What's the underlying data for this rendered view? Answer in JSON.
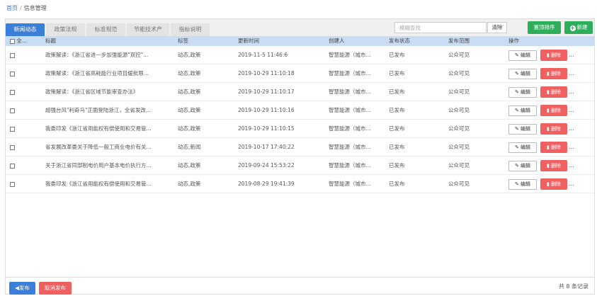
{
  "breadcrumb": {
    "home": "首页",
    "separator": "/",
    "current": "信息管理"
  },
  "tabs": [
    {
      "label": "新闻动态",
      "active": true
    },
    {
      "label": "政策法规",
      "active": false
    },
    {
      "label": "标准规范",
      "active": false
    },
    {
      "label": "节能技术产",
      "active": false
    },
    {
      "label": "指标说明",
      "active": false
    }
  ],
  "search": {
    "placeholder": "模糊查找",
    "value": ""
  },
  "buttons": {
    "clear": "清除",
    "sort": "置顶排序",
    "new": "新建",
    "edit": "编辑",
    "delete": "删除",
    "more": "...",
    "publish": "发布",
    "unpublish": "取消发布"
  },
  "table": {
    "headers": {
      "select_all": "全...",
      "title": "标题",
      "tags": "标签",
      "updated": "更新时间",
      "creator": "创建人",
      "status": "发布状态",
      "scope": "发布范围",
      "actions": "操作"
    },
    "rows": [
      {
        "title": "政策解读：《浙江省进一步加强能源\"双控\"...",
        "tags": "动态,政策",
        "updated": "2019-11-5 11:46:6",
        "creator": "智慧能源（城市...",
        "status": "已发布",
        "scope": "公众可见"
      },
      {
        "title": "政策解读：《浙江省高耗能行业项目缓批限...",
        "tags": "动态,政策",
        "updated": "2019-10-29 11:10:18",
        "creator": "智慧能源（城市...",
        "status": "已发布",
        "scope": "公众可见"
      },
      {
        "title": "政策解读：《浙江省区域节能审查办法》",
        "tags": "动态,政策",
        "updated": "2019-10-29 11:10:17",
        "creator": "智慧能源（城市...",
        "status": "已发布",
        "scope": "公众可见"
      },
      {
        "title": "超强台风\"利奇马\"正面登陆浙江，全省发改...",
        "tags": "动态,政策",
        "updated": "2019-10-29 11:10:16",
        "creator": "智慧能源（城市...",
        "status": "已发布",
        "scope": "公众可见"
      },
      {
        "title": "我委印发《浙江省用能权有偿使用和交易管...",
        "tags": "动态,政策",
        "updated": "2019-10-29 11:10:15",
        "creator": "智慧能源（城市...",
        "status": "已发布",
        "scope": "公众可见"
      },
      {
        "title": "省发展改革委关于降低一般工商业电价有关...",
        "tags": "动态,新闻",
        "updated": "2019-10-17 17:40:22",
        "creator": "智慧能源（城市...",
        "status": "已发布",
        "scope": "公众可见"
      },
      {
        "title": "关于浙江省同部制电价用户基本电价执行方...",
        "tags": "动态,政策",
        "updated": "2019-09-24 15:53:22",
        "creator": "智慧能源（城市...",
        "status": "已发布",
        "scope": "公众可见"
      },
      {
        "title": "我委印发《浙江省用能权有偿使用和交易管...",
        "tags": "动态,政策",
        "updated": "2019-08-29 19:41:39",
        "creator": "智慧能源（城市...",
        "status": "已发布",
        "scope": "公众可见"
      }
    ]
  },
  "footer": {
    "total": "共 8 条记录"
  },
  "colors": {
    "primary": "#3a7fd9",
    "success": "#2eae5a",
    "danger": "#f06060",
    "header_bg": "#c8dcf3"
  },
  "icons": {
    "edit": "edit-icon",
    "delete": "trash-icon",
    "new": "plus-circle-icon",
    "publish": "send-icon"
  }
}
